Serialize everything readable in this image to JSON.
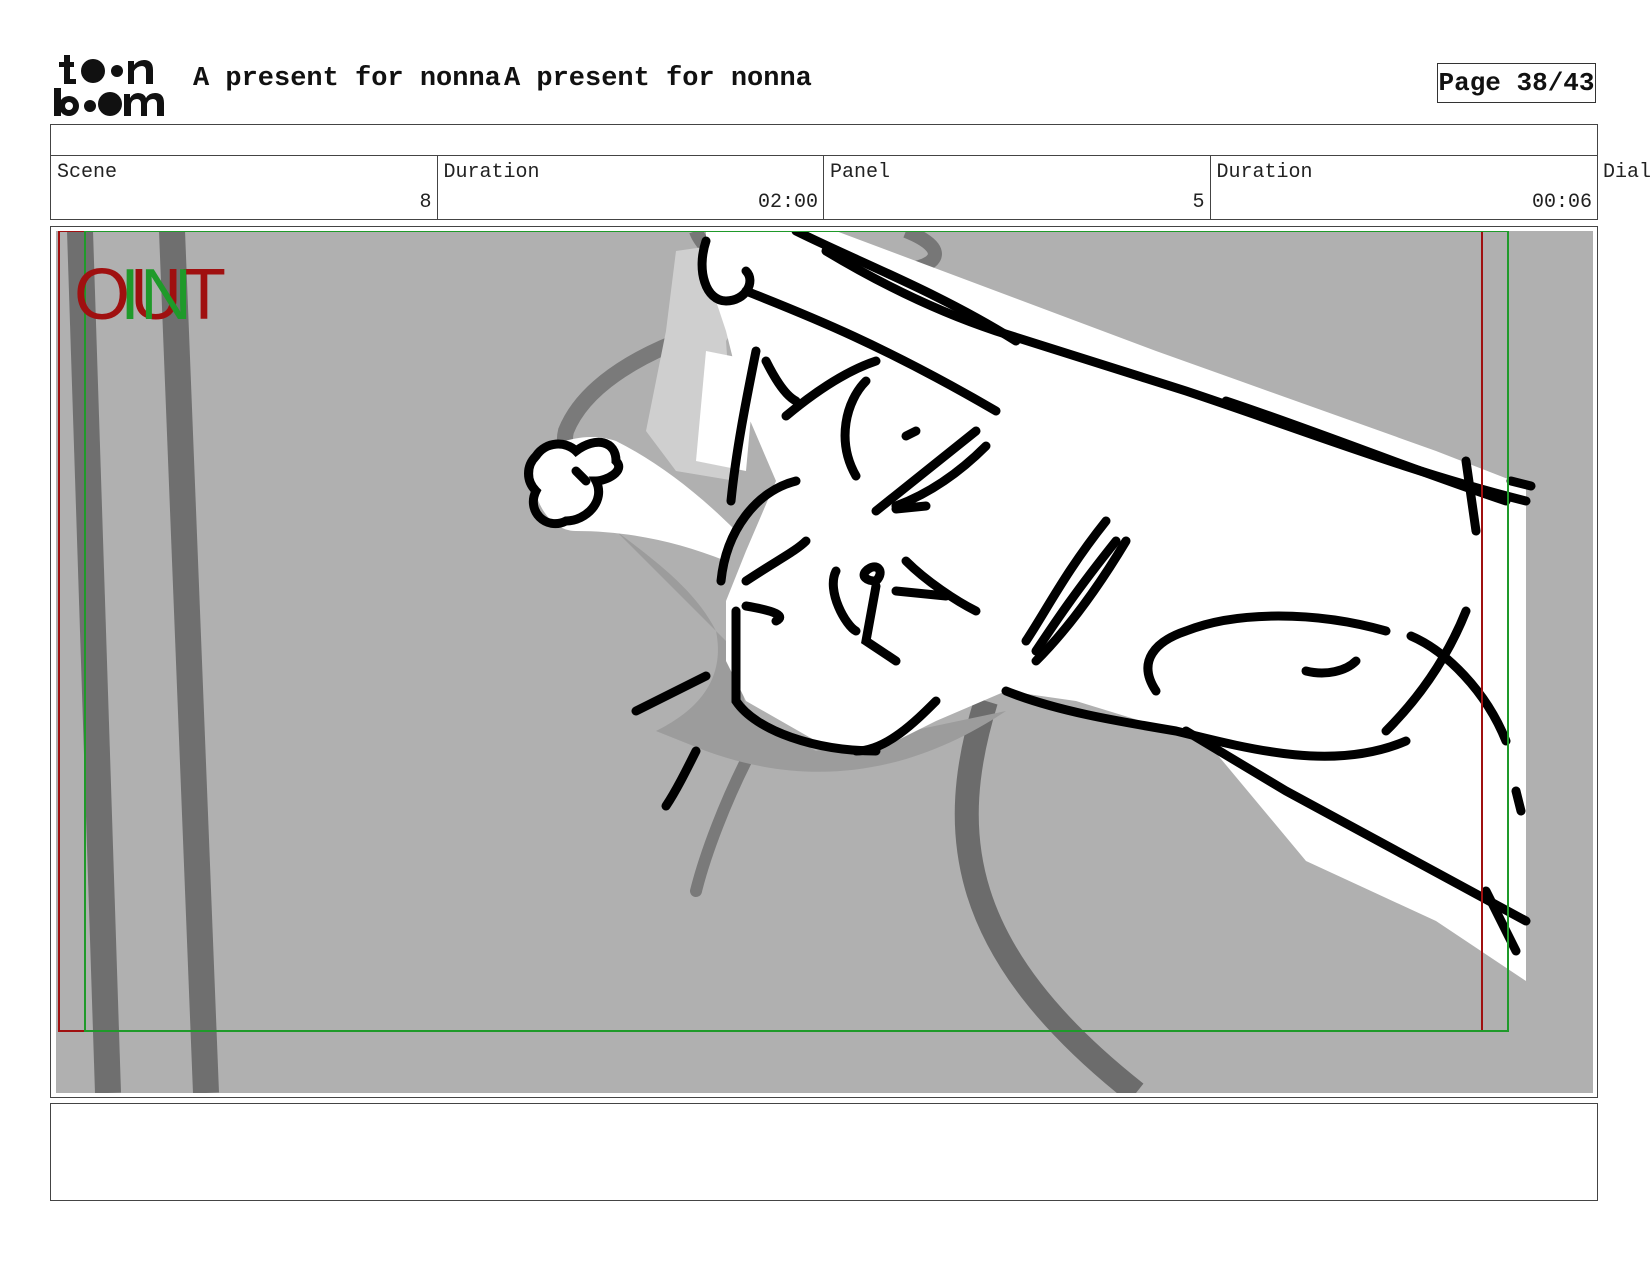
{
  "header": {
    "project_title": "A present for nonna",
    "scene_title": "A present for nonna",
    "page_label": "Page 38/43"
  },
  "info": {
    "scene_label": "Scene",
    "scene_value": "8",
    "scene_duration_label": "Duration",
    "scene_duration_value": "02:00",
    "panel_label": "Panel",
    "panel_value": "5",
    "panel_duration_label": "Duration",
    "panel_duration_value": "00:06",
    "dialog_label": "Dial"
  },
  "overlay": {
    "out_label": "OUT",
    "in_label": "IN",
    "out_color": "#a01010",
    "in_color": "#1f9a2a"
  },
  "colors": {
    "panel_background": "#b0b0b0",
    "outline": "#444444"
  },
  "logo": {
    "line1": "toon",
    "line2": "boom"
  }
}
